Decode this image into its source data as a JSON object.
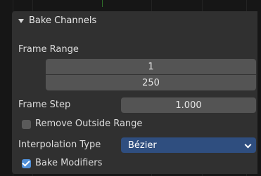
{
  "panel": {
    "title": "Bake Channels",
    "frame_range": {
      "label": "Frame Range",
      "start": "1",
      "end": "250"
    },
    "frame_step": {
      "label": "Frame Step",
      "value": "1.000"
    },
    "remove_outside_range": {
      "label": "Remove Outside Range",
      "checked": false
    },
    "interpolation_type": {
      "label": "Interpolation Type",
      "value": "Bézier"
    },
    "bake_modifiers": {
      "label": "Bake Modifiers",
      "checked": true
    }
  },
  "icons": {
    "expand": "triangle-down-icon",
    "checkbox_checked": "checkmark-icon",
    "dropdown": "chevron-down-icon"
  },
  "colors": {
    "panel_bg": "#303030",
    "field_bg": "#545454",
    "select_bg": "#2f4e7f",
    "checkbox_checked": "#4f8ed6",
    "checkbox_unchecked": "#5a5a5a"
  }
}
